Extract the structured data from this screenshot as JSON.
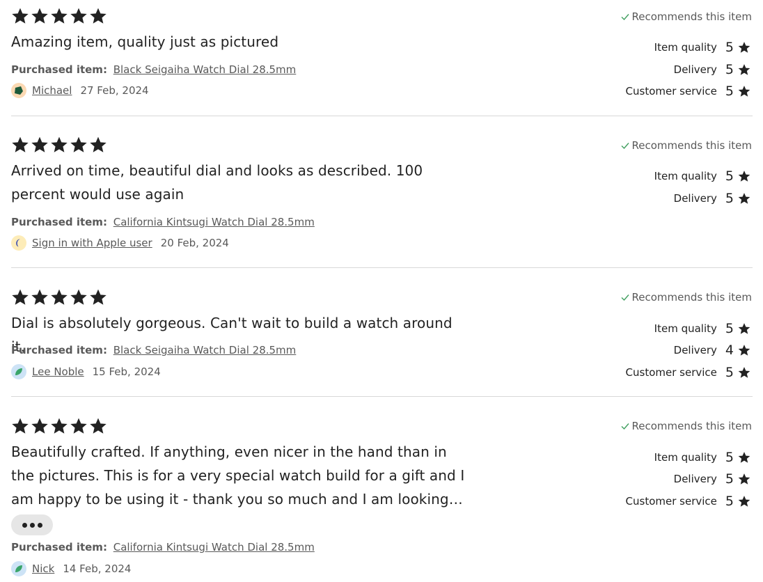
{
  "recommends_label": "Recommends this item",
  "purchased_label": "Purchased item:",
  "colors": {
    "text": "#222222",
    "muted": "#595959",
    "check": "#3f9e5e",
    "divider": "#d8d8d8"
  },
  "reviews": [
    {
      "stars": 5,
      "text": "Amazing item, quality just as pictured",
      "item": "Black Seigaiha Watch Dial 28.5mm",
      "reviewer": "Michael",
      "date": "27 Feb, 2024",
      "avatar_icon": "green-pentagon-icon",
      "ratings": [
        {
          "label": "Item quality",
          "value": "5"
        },
        {
          "label": "Delivery",
          "value": "5"
        },
        {
          "label": "Customer service",
          "value": "5"
        }
      ]
    },
    {
      "stars": 5,
      "text": "Arrived on time, beautiful dial and looks as described. 100 percent would use again",
      "item": "California Kintsugi Watch Dial 28.5mm",
      "reviewer": "Sign in with Apple user",
      "date": "20 Feb, 2024",
      "avatar_icon": "blue-crescent-icon",
      "ratings": [
        {
          "label": "Item quality",
          "value": "5"
        },
        {
          "label": "Delivery",
          "value": "5"
        }
      ]
    },
    {
      "stars": 5,
      "text": "Dial is absolutely gorgeous. Can't wait to build a watch around it.",
      "item": "Black Seigaiha Watch Dial 28.5mm",
      "reviewer": "Lee Noble",
      "date": "15 Feb, 2024",
      "avatar_icon": "green-leaf-icon",
      "ratings": [
        {
          "label": "Item quality",
          "value": "5"
        },
        {
          "label": "Delivery",
          "value": "4"
        },
        {
          "label": "Customer service",
          "value": "5"
        }
      ]
    },
    {
      "stars": 5,
      "text": "Beautifully crafted. If anything, even nicer in the hand than in the pictures. This is for a very special watch build for a gift and I am happy to be using it - thank you so much and I am looking forwar...",
      "item": "California Kintsugi Watch Dial 28.5mm",
      "reviewer": "Nick",
      "date": "14 Feb, 2024",
      "avatar_icon": "green-leaf-icon",
      "more_icon": "ellipsis-icon",
      "ratings": [
        {
          "label": "Item quality",
          "value": "5"
        },
        {
          "label": "Delivery",
          "value": "5"
        },
        {
          "label": "Customer service",
          "value": "5"
        }
      ]
    }
  ]
}
